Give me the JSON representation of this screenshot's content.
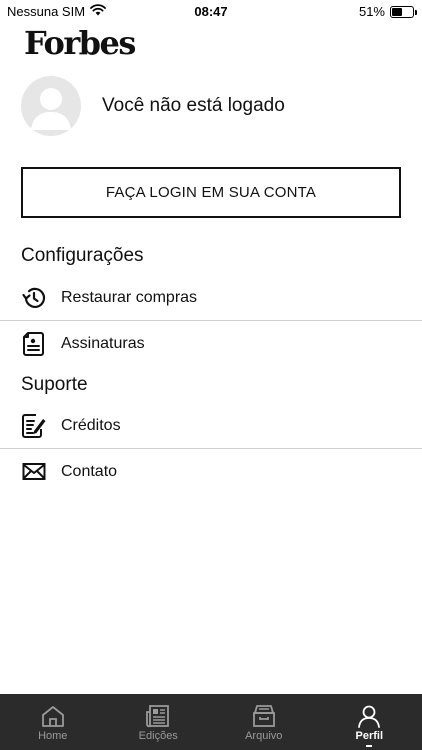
{
  "status_bar": {
    "carrier": "Nessuna SIM",
    "time": "08:47",
    "battery": "51%",
    "battery_level": 0.51
  },
  "header": {
    "logo": "Forbes"
  },
  "profile": {
    "status_text": "Você não está logado",
    "login_button": "FAÇA LOGIN EM SUA CONTA"
  },
  "settings": {
    "title": "Configurações",
    "items": [
      {
        "label": "Restaurar compras",
        "icon": "history-icon"
      },
      {
        "label": "Assinaturas",
        "icon": "subscription-icon"
      }
    ]
  },
  "support": {
    "title": "Suporte",
    "items": [
      {
        "label": "Créditos",
        "icon": "credits-icon"
      },
      {
        "label": "Contato",
        "icon": "mail-icon"
      }
    ]
  },
  "tab_bar": {
    "active": "Perfil",
    "tabs": [
      {
        "label": "Home",
        "icon": "home-icon"
      },
      {
        "label": "Edições",
        "icon": "newspaper-icon"
      },
      {
        "label": "Arquivo",
        "icon": "archive-box-icon"
      },
      {
        "label": "Perfil",
        "icon": "user-icon"
      }
    ]
  }
}
